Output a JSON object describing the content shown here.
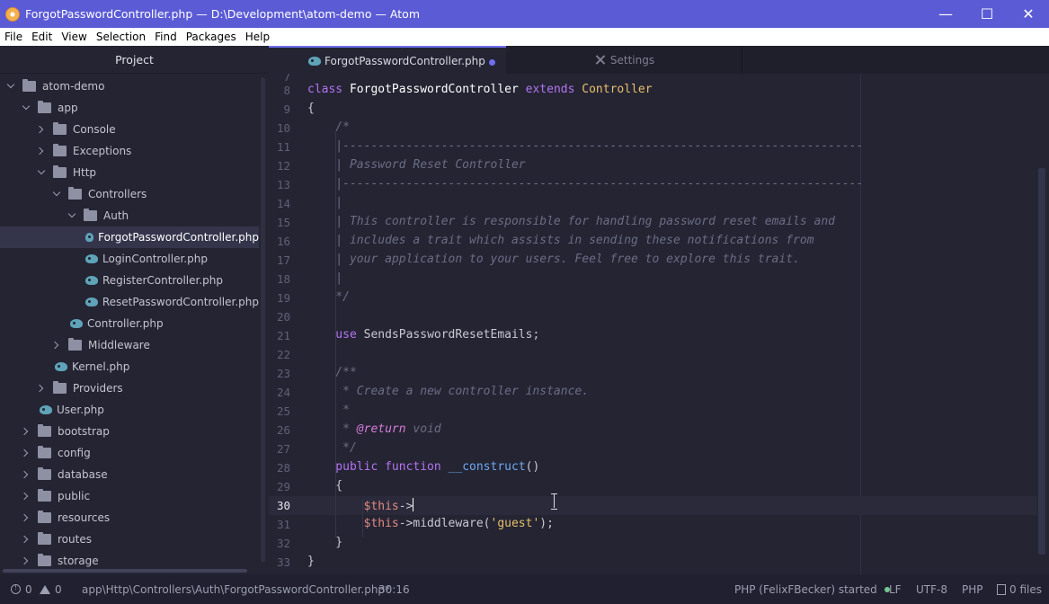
{
  "window": {
    "title": "ForgotPasswordController.php — D:\\Development\\atom-demo — Atom",
    "controls": {
      "minimize": "—",
      "maximize": "☐",
      "close": "✕"
    }
  },
  "menu": [
    "File",
    "Edit",
    "View",
    "Selection",
    "Find",
    "Packages",
    "Help"
  ],
  "tree": {
    "header": "Project",
    "rows": [
      {
        "label": "atom-demo",
        "type": "folder",
        "state": "expanded",
        "depth": 0
      },
      {
        "label": "app",
        "type": "folder",
        "state": "expanded",
        "depth": 1
      },
      {
        "label": "Console",
        "type": "folder",
        "state": "collapsed",
        "depth": 2
      },
      {
        "label": "Exceptions",
        "type": "folder",
        "state": "collapsed",
        "depth": 2
      },
      {
        "label": "Http",
        "type": "folder",
        "state": "expanded",
        "depth": 2
      },
      {
        "label": "Controllers",
        "type": "folder",
        "state": "expanded",
        "depth": 3
      },
      {
        "label": "Auth",
        "type": "folder",
        "state": "expanded",
        "depth": 4
      },
      {
        "label": "ForgotPasswordController.php",
        "type": "file",
        "depth": 5,
        "selected": true
      },
      {
        "label": "LoginController.php",
        "type": "file",
        "depth": 5
      },
      {
        "label": "RegisterController.php",
        "type": "file",
        "depth": 5
      },
      {
        "label": "ResetPasswordController.php",
        "type": "file",
        "depth": 5
      },
      {
        "label": "Controller.php",
        "type": "file",
        "depth": 4
      },
      {
        "label": "Middleware",
        "type": "folder",
        "state": "collapsed",
        "depth": 3
      },
      {
        "label": "Kernel.php",
        "type": "file",
        "depth": 3
      },
      {
        "label": "Providers",
        "type": "folder",
        "state": "collapsed",
        "depth": 2
      },
      {
        "label": "User.php",
        "type": "file",
        "depth": 2
      },
      {
        "label": "bootstrap",
        "type": "folder",
        "state": "collapsed",
        "depth": 1
      },
      {
        "label": "config",
        "type": "folder",
        "state": "collapsed",
        "depth": 1
      },
      {
        "label": "database",
        "type": "folder",
        "state": "collapsed",
        "depth": 1
      },
      {
        "label": "public",
        "type": "folder",
        "state": "collapsed",
        "depth": 1
      },
      {
        "label": "resources",
        "type": "folder",
        "state": "collapsed",
        "depth": 1
      },
      {
        "label": "routes",
        "type": "folder",
        "state": "collapsed",
        "depth": 1
      },
      {
        "label": "storage",
        "type": "folder",
        "state": "collapsed",
        "depth": 1
      }
    ]
  },
  "tabs": {
    "active": "ForgotPasswordController.php",
    "inactive": "Settings"
  },
  "editor": {
    "first_partial_line": "7",
    "current_line": "30",
    "lines": [
      {
        "n": "8",
        "tokens": [
          [
            "kw",
            "class "
          ],
          [
            "cls",
            "ForgotPasswordController "
          ],
          [
            "kw",
            "extends "
          ],
          [
            "cls2",
            "Controller"
          ]
        ]
      },
      {
        "n": "9",
        "tokens": [
          [
            "plain",
            "{"
          ]
        ]
      },
      {
        "n": "10",
        "tokens": [
          [
            "cmt",
            "    /*"
          ]
        ]
      },
      {
        "n": "11",
        "tokens": [
          [
            "cmt",
            "    |--------------------------------------------------------------------------"
          ]
        ]
      },
      {
        "n": "12",
        "tokens": [
          [
            "cmt",
            "    | Password Reset Controller"
          ]
        ]
      },
      {
        "n": "13",
        "tokens": [
          [
            "cmt",
            "    |--------------------------------------------------------------------------"
          ]
        ]
      },
      {
        "n": "14",
        "tokens": [
          [
            "cmt",
            "    |"
          ]
        ]
      },
      {
        "n": "15",
        "tokens": [
          [
            "cmt",
            "    | This controller is responsible for handling password reset emails and"
          ]
        ]
      },
      {
        "n": "16",
        "tokens": [
          [
            "cmt",
            "    | includes a trait which assists in sending these notifications from"
          ]
        ]
      },
      {
        "n": "17",
        "tokens": [
          [
            "cmt",
            "    | your application to your users. Feel free to explore this trait."
          ]
        ]
      },
      {
        "n": "18",
        "tokens": [
          [
            "cmt",
            "    |"
          ]
        ]
      },
      {
        "n": "19",
        "tokens": [
          [
            "cmt",
            "    */"
          ]
        ]
      },
      {
        "n": "20",
        "tokens": []
      },
      {
        "n": "21",
        "tokens": [
          [
            "kw",
            "    use "
          ],
          [
            "plain",
            "SendsPasswordResetEmails;"
          ]
        ]
      },
      {
        "n": "22",
        "tokens": []
      },
      {
        "n": "23",
        "tokens": [
          [
            "cmt",
            "    /**"
          ]
        ]
      },
      {
        "n": "24",
        "tokens": [
          [
            "cmt",
            "     * Create a new controller instance."
          ]
        ]
      },
      {
        "n": "25",
        "tokens": [
          [
            "cmt",
            "     *"
          ]
        ]
      },
      {
        "n": "26",
        "tokens": [
          [
            "cmt",
            "     * "
          ],
          [
            "tag",
            "@return"
          ],
          [
            "cmt",
            " void"
          ]
        ]
      },
      {
        "n": "27",
        "tokens": [
          [
            "cmt",
            "     */"
          ]
        ]
      },
      {
        "n": "28",
        "tokens": [
          [
            "kw",
            "    public "
          ],
          [
            "kw",
            "function "
          ],
          [
            "fn",
            "__construct"
          ],
          [
            "plain",
            "()"
          ]
        ]
      },
      {
        "n": "29",
        "tokens": [
          [
            "plain",
            "    {"
          ]
        ]
      },
      {
        "n": "30",
        "tokens": [
          [
            "var",
            "        $this"
          ],
          [
            "plain",
            "->"
          ]
        ],
        "cursor": true
      },
      {
        "n": "31",
        "tokens": [
          [
            "var",
            "        $this"
          ],
          [
            "plain",
            "->middleware("
          ],
          [
            "str",
            "'guest'"
          ],
          [
            "plain",
            ");"
          ]
        ]
      },
      {
        "n": "32",
        "tokens": [
          [
            "plain",
            "    }"
          ]
        ]
      },
      {
        "n": "33",
        "tokens": [
          [
            "plain",
            "}"
          ]
        ]
      }
    ]
  },
  "status": {
    "errors": "0",
    "warnings": "0",
    "path": "app\\Http\\Controllers\\Auth\\ForgotPasswordController.php*",
    "cursor_pos": "30:16",
    "language_server": "PHP (FelixFBecker) started",
    "line_ending": "LF",
    "encoding": "UTF-8",
    "grammar": "PHP",
    "files": "0 files",
    "colors": {
      "accent": "#5b5bd6",
      "server_ok": "#73c991"
    }
  }
}
